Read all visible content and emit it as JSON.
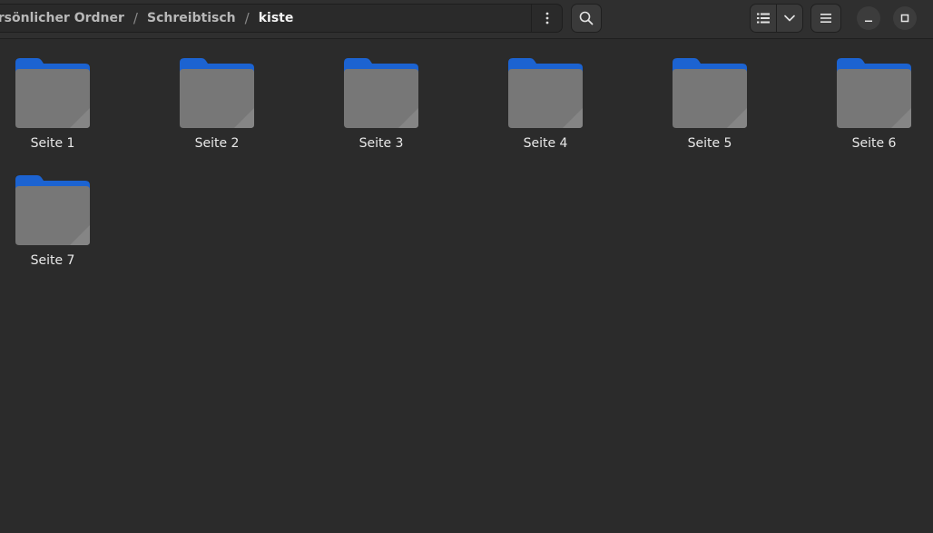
{
  "window": {
    "breadcrumbs": [
      {
        "label": "Persönlicher Ordner"
      },
      {
        "label": "Schreibtisch"
      },
      {
        "label": "kiste"
      }
    ],
    "separator": "/"
  },
  "toolbar": {
    "path_menu_icon": "vertical-dots-icon",
    "search_icon": "search-icon",
    "view_list_icon": "list-view-icon",
    "view_dropdown_icon": "chevron-down-icon",
    "main_menu_icon": "hamburger-menu-icon",
    "minimize_icon": "minimize-icon",
    "maximize_icon": "maximize-icon"
  },
  "files": [
    {
      "name": "Seite 1",
      "type": "folder"
    },
    {
      "name": "Seite 2",
      "type": "folder"
    },
    {
      "name": "Seite 3",
      "type": "folder"
    },
    {
      "name": "Seite 4",
      "type": "folder"
    },
    {
      "name": "Seite 5",
      "type": "folder"
    },
    {
      "name": "Seite 6",
      "type": "folder"
    },
    {
      "name": "Seite 7",
      "type": "folder"
    }
  ],
  "colors": {
    "folder_tab": "#1c63d1",
    "folder_body": "#777777",
    "background": "#2b2b2b"
  }
}
